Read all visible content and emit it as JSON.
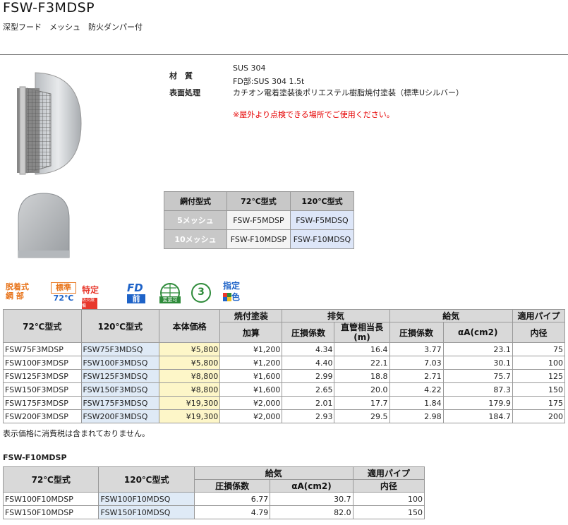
{
  "page": {
    "title": "FSW-F3MDSP",
    "subtitle": "深型フード　メッシュ　防火ダンパー付"
  },
  "specs": {
    "material_label": "材　質",
    "material_value1": "SUS 304",
    "material_value2": "FD部:SUS 304 1.5t",
    "surface_label": "表面処理",
    "surface_value": "カチオン電着塗装後ポリエステル樹脂焼付塗装（標準Uシルバー）",
    "warning": "※屋外より点検できる場所でご使用ください。"
  },
  "mesh_table": {
    "headers": [
      "網付型式",
      "72℃型式",
      "120℃型式"
    ],
    "rows": [
      [
        "5メッシュ",
        "FSW-F5MDSP",
        "FSW-F5MDSQ"
      ],
      [
        "10メッシュ",
        "FSW-F10MDSP",
        "FSW-F10MDSQ"
      ]
    ]
  },
  "badges": {
    "b1_l1": "脱着式",
    "b1_l2": "網 部",
    "b2_l1": "標準",
    "b2_l2": "72℃",
    "b3_l1": "特定",
    "b3_l2": "防火設備",
    "b4_l1": "FD",
    "b4_l2": "前",
    "b5": "変更可",
    "b6": "3",
    "b7_l1": "指定",
    "b7_l2": "色",
    "colors": {
      "red": "#e8382c",
      "orange": "#e8761e",
      "blue": "#1e63c8",
      "green": "#2e8b3a"
    }
  },
  "main_table": {
    "h_72": "72℃型式",
    "h_120": "120℃型式",
    "h_price": "本体価格",
    "h_bake": "焼付塗装",
    "h_bake_sub": "加算",
    "h_exhaust": "排気",
    "h_ex_loss": "圧損係数",
    "h_ex_len": "直管相当長\n(m)",
    "h_supply": "給気",
    "h_su_loss": "圧損係数",
    "h_su_aa": "αA(cm2)",
    "h_pipe": "適用パイプ",
    "h_pipe_sub": "内径",
    "rows": [
      [
        "FSW75F3MDSP",
        "FSW75F3MDSQ",
        "¥5,800",
        "¥1,200",
        "4.34",
        "16.4",
        "3.77",
        "23.1",
        "75"
      ],
      [
        "FSW100F3MDSP",
        "FSW100F3MDSQ",
        "¥5,800",
        "¥1,200",
        "4.40",
        "22.1",
        "7.03",
        "30.1",
        "100"
      ],
      [
        "FSW125F3MDSP",
        "FSW125F3MDSQ",
        "¥8,800",
        "¥1,600",
        "2.99",
        "18.8",
        "2.71",
        "75.7",
        "125"
      ],
      [
        "FSW150F3MDSP",
        "FSW150F3MDSQ",
        "¥8,800",
        "¥1,600",
        "2.65",
        "20.0",
        "4.22",
        "87.3",
        "150"
      ],
      [
        "FSW175F3MDSP",
        "FSW175F3MDSQ",
        "¥19,300",
        "¥2,000",
        "2.01",
        "17.7",
        "1.84",
        "179.9",
        "175"
      ],
      [
        "FSW200F3MDSP",
        "FSW200F3MDSQ",
        "¥19,300",
        "¥2,000",
        "2.93",
        "29.5",
        "2.98",
        "184.7",
        "200"
      ]
    ],
    "note": "表示価格に消費税は含まれておりません。"
  },
  "sub_table": {
    "title": "FSW-F10MDSP",
    "h_72": "72℃型式",
    "h_120": "120℃型式",
    "h_supply": "給気",
    "h_loss": "圧損係数",
    "h_aa": "αA(cm2)",
    "h_pipe": "適用パイプ",
    "h_pipe_sub": "内径",
    "rows": [
      [
        "FSW100F10MDSP",
        "FSW100F10MDSQ",
        "6.77",
        "30.7",
        "100"
      ],
      [
        "FSW150F10MDSP",
        "FSW150F10MDSQ",
        "4.79",
        "82.0",
        "150"
      ]
    ]
  }
}
